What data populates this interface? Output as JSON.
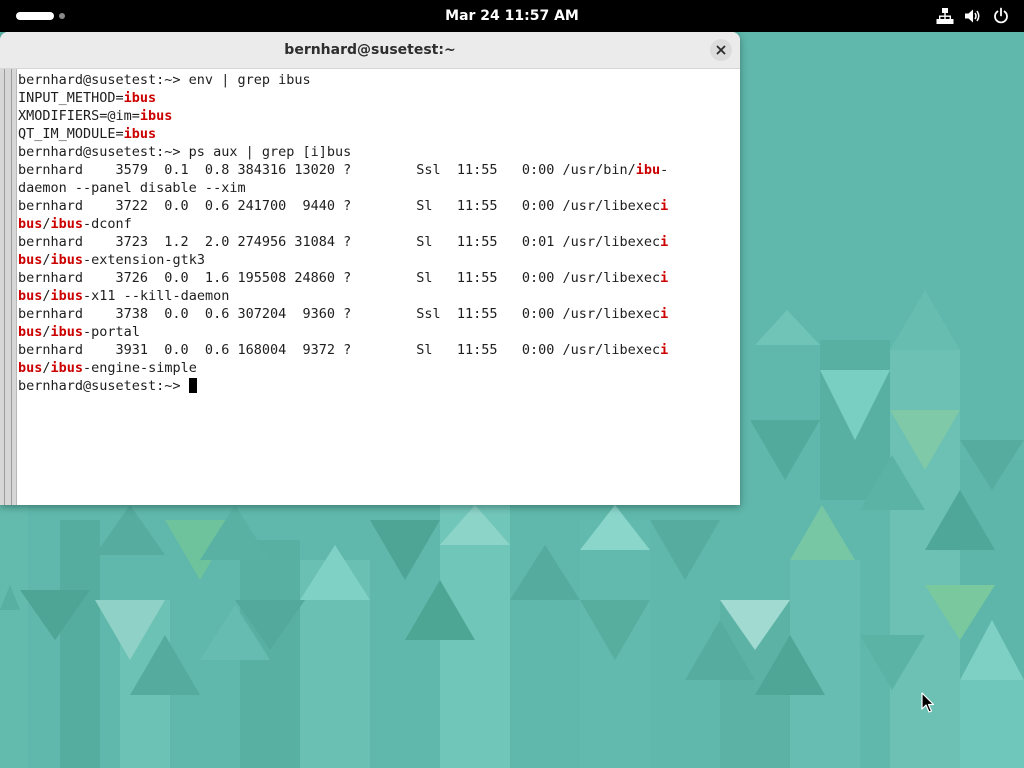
{
  "topbar": {
    "clock": "Mar 24  11:57 AM",
    "tray_icons": [
      "network-wired-icon",
      "volume-icon",
      "power-icon"
    ]
  },
  "terminal": {
    "title": "bernhard@susetest:~",
    "highlight_color": "#cc0000",
    "lines": [
      [
        {
          "t": "bernhard@susetest:~> env | grep ibus"
        }
      ],
      [
        {
          "t": "INPUT_METHOD="
        },
        {
          "t": "ibus",
          "hl": true
        }
      ],
      [
        {
          "t": "XMODIFIERS=@im="
        },
        {
          "t": "ibus",
          "hl": true
        }
      ],
      [
        {
          "t": "QT_IM_MODULE="
        },
        {
          "t": "ibus",
          "hl": true
        }
      ],
      [
        {
          "t": "bernhard@susetest:~> ps aux | grep [i]bus"
        }
      ],
      [
        {
          "t": "bernhard    3579  0.1  0.8 384316 13020 ?        Ssl  11:55   0:00 /usr/bin/"
        },
        {
          "t": "ibu",
          "hl": true
        },
        {
          "t": "-"
        }
      ],
      [
        {
          "t": "daemon --panel disable --xim"
        }
      ],
      [
        {
          "t": "bernhard    3722  0.0  0.6 241700  9440 ?        Sl   11:55   0:00 /usr/libexec"
        },
        {
          "t": "i",
          "hl": true
        }
      ],
      [
        {
          "t": "bus",
          "hl": true
        },
        {
          "t": "/"
        },
        {
          "t": "ibus",
          "hl": true
        },
        {
          "t": "-dconf"
        }
      ],
      [
        {
          "t": "bernhard    3723  1.2  2.0 274956 31084 ?        Sl   11:55   0:01 /usr/libexec"
        },
        {
          "t": "i",
          "hl": true
        }
      ],
      [
        {
          "t": "bus",
          "hl": true
        },
        {
          "t": "/"
        },
        {
          "t": "ibus",
          "hl": true
        },
        {
          "t": "-extension-gtk3"
        }
      ],
      [
        {
          "t": "bernhard    3726  0.0  1.6 195508 24860 ?        Sl   11:55   0:00 /usr/libexec"
        },
        {
          "t": "i",
          "hl": true
        }
      ],
      [
        {
          "t": "bus",
          "hl": true
        },
        {
          "t": "/"
        },
        {
          "t": "ibus",
          "hl": true
        },
        {
          "t": "-x11 --kill-daemon"
        }
      ],
      [
        {
          "t": "bernhard    3738  0.0  0.6 307204  9360 ?        Ssl  11:55   0:00 /usr/libexec"
        },
        {
          "t": "i",
          "hl": true
        }
      ],
      [
        {
          "t": "bus",
          "hl": true
        },
        {
          "t": "/"
        },
        {
          "t": "ibus",
          "hl": true
        },
        {
          "t": "-portal"
        }
      ],
      [
        {
          "t": "bernhard    3931  0.0  0.6 168004  9372 ?        Sl   11:55   0:00 /usr/libexec"
        },
        {
          "t": "i",
          "hl": true
        }
      ],
      [
        {
          "t": "bus",
          "hl": true
        },
        {
          "t": "/"
        },
        {
          "t": "ibus",
          "hl": true
        },
        {
          "t": "-engine-simple"
        }
      ],
      [
        {
          "t": "bernhard@susetest:~> "
        }
      ]
    ]
  }
}
